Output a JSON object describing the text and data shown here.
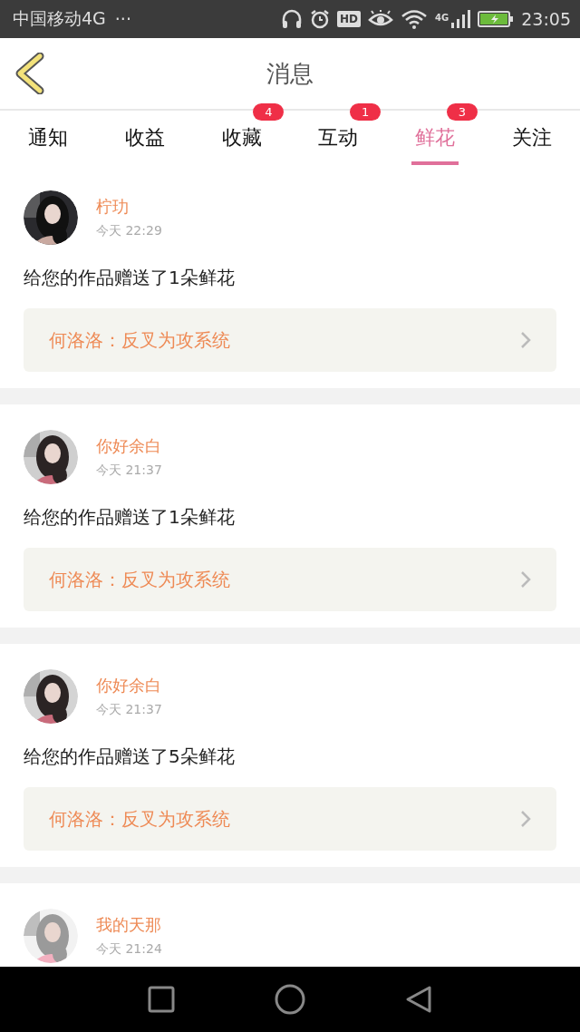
{
  "status_bar": {
    "carrier": "中国移动4G",
    "more": "···",
    "hd": "HD",
    "network": "4G",
    "time": "23:05"
  },
  "header": {
    "title": "消息"
  },
  "tabs": [
    {
      "label": "通知",
      "selected": false
    },
    {
      "label": "收益",
      "selected": false
    },
    {
      "label": "收藏",
      "selected": false,
      "badge": "4"
    },
    {
      "label": "互动",
      "selected": false,
      "badge": "1"
    },
    {
      "label": "鲜花",
      "selected": true,
      "badge": "3"
    },
    {
      "label": "关注",
      "selected": false
    }
  ],
  "messages": [
    {
      "name": "柠玏",
      "time": "今天 22:29",
      "text": "给您的作品赠送了1朵鲜花",
      "work": "何洛洛：反叉为攻系统"
    },
    {
      "name": "你好余白",
      "time": "今天 21:37",
      "text": "给您的作品赠送了1朵鲜花",
      "work": "何洛洛：反叉为攻系统"
    },
    {
      "name": "你好余白",
      "time": "今天 21:37",
      "text": "给您的作品赠送了5朵鲜花",
      "work": "何洛洛：反叉为攻系统"
    },
    {
      "name": "我的天那",
      "time": "今天 21:24"
    }
  ]
}
